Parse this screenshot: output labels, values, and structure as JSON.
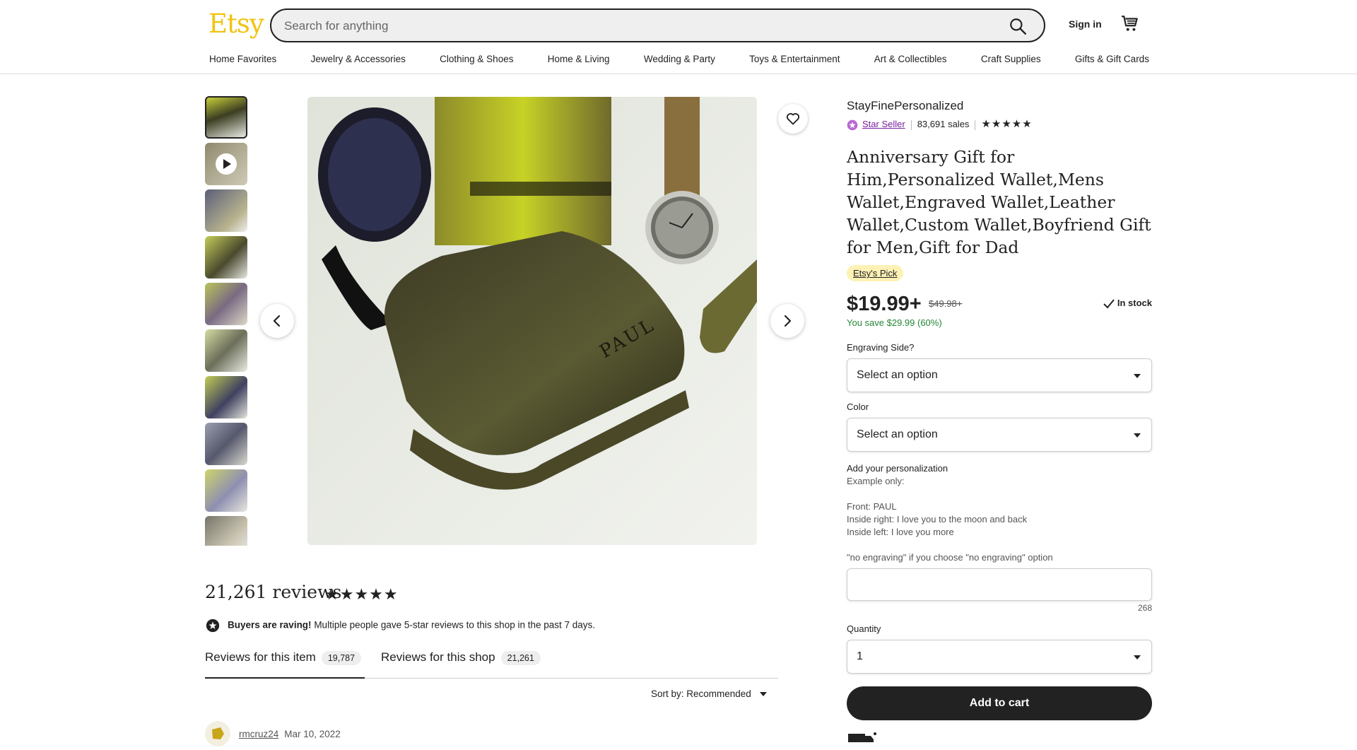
{
  "header": {
    "logo": "Etsy",
    "search_placeholder": "Search for anything",
    "sign_in": "Sign in"
  },
  "nav": [
    "Home Favorites",
    "Jewelry & Accessories",
    "Clothing & Shoes",
    "Home & Living",
    "Wedding & Party",
    "Toys & Entertainment",
    "Art & Collectibles",
    "Craft Supplies",
    "Gifts & Gift Cards"
  ],
  "gallery": {
    "thumbnail_count": 10,
    "video_thumbnail_index": 1
  },
  "listing": {
    "shop_name": "StayFinePersonalized",
    "star_seller": "Star Seller",
    "sales": "83,691 sales",
    "rating_stars": "★★★★★",
    "title": "Anniversary Gift for Him,Personalized Wallet,Mens Wallet,Engraved Wallet,Leather Wallet,Custom Wallet,Boyfriend Gift for Men,Gift for Dad",
    "pick_badge": "Etsy's Pick",
    "price": "$19.99+",
    "original_price": "$49.98+",
    "stock": "In stock",
    "savings": "You save $29.99 (60%)",
    "engraving_label": "Engraving Side?",
    "engraving_value": "Select an option",
    "color_label": "Color",
    "color_value": "Select an option",
    "personalization_title": "Add your personalization",
    "personalization_text": "Example only:\n\nFront: PAUL\nInside right: I love you to the moon and back\nInside left: I love you more\n\n\"no engraving\" if you choose \"no engraving\" option",
    "char_count": "268",
    "quantity_label": "Quantity",
    "quantity_value": "1",
    "add_to_cart": "Add to cart"
  },
  "reviews": {
    "title": "21,261 reviews",
    "stars": "★★★★★",
    "raving_bold": "Buyers are raving!",
    "raving_text": " Multiple people gave 5-star reviews to this shop in the past 7 days.",
    "tab_item": "Reviews for this item",
    "tab_item_count": "19,787",
    "tab_shop": "Reviews for this shop",
    "tab_shop_count": "21,261",
    "sort": "Sort by: Recommended",
    "first_user": "rmcruz24",
    "first_date": "Mar 10, 2022"
  },
  "colors": {
    "brand": "#F1C40F",
    "savings_green": "#258635",
    "star_seller_purple": "#7a1fa2",
    "pick_bg": "#fdf1b5"
  },
  "icons": [
    "search-icon",
    "cart-icon",
    "heart-icon",
    "chevron-left-icon",
    "chevron-right-icon",
    "play-icon",
    "check-icon",
    "star-seller-icon",
    "raving-badge-icon",
    "truck-icon"
  ]
}
